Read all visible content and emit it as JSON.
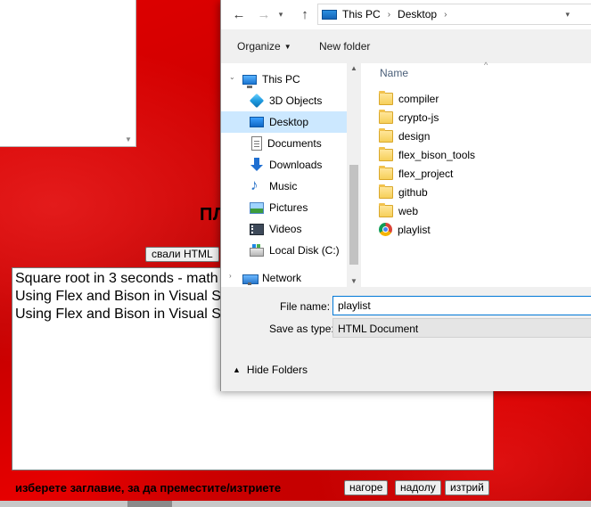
{
  "page": {
    "heading_visible": "ПЛ",
    "download_button_label": "свали HTML",
    "playlist_items": [
      "Square root in 3 seconds - math",
      "Using Flex and Bison in Visual S",
      "Using Flex and Bison in Visual S"
    ],
    "hint_text": "изберете заглавие, за да преместите/изтриете",
    "buttons": {
      "up_label": "нагоре",
      "down_label": "надолу",
      "delete_label": "изтрий"
    }
  },
  "dialog": {
    "nav": {
      "back_icon": "arrow-left-icon",
      "forward_icon": "arrow-right-icon",
      "recent_icon": "chevron-down-icon",
      "up_icon": "arrow-up-icon"
    },
    "breadcrumb": [
      "This PC",
      "Desktop"
    ],
    "toolbar": {
      "organize_label": "Organize",
      "new_folder_label": "New folder"
    },
    "nav_pane": [
      {
        "label": "This PC",
        "icon": "computer-icon"
      },
      {
        "label": "3D Objects",
        "icon": "cube-icon"
      },
      {
        "label": "Desktop",
        "icon": "desktop-icon",
        "selected": true
      },
      {
        "label": "Documents",
        "icon": "document-icon"
      },
      {
        "label": "Downloads",
        "icon": "download-icon"
      },
      {
        "label": "Music",
        "icon": "music-icon"
      },
      {
        "label": "Pictures",
        "icon": "picture-icon"
      },
      {
        "label": "Videos",
        "icon": "video-icon"
      },
      {
        "label": "Local Disk (C:)",
        "icon": "disk-icon"
      },
      {
        "label": "Network",
        "icon": "network-icon"
      }
    ],
    "file_list": {
      "column_name": "Name",
      "items": [
        {
          "name": "compiler",
          "icon": "folder-icon"
        },
        {
          "name": "crypto-js",
          "icon": "folder-icon"
        },
        {
          "name": "design",
          "icon": "folder-icon"
        },
        {
          "name": "flex_bison_tools",
          "icon": "folder-icon"
        },
        {
          "name": "flex_project",
          "icon": "folder-icon"
        },
        {
          "name": "github",
          "icon": "folder-icon"
        },
        {
          "name": "web",
          "icon": "folder-icon"
        },
        {
          "name": "playlist",
          "icon": "chrome-html-icon"
        }
      ]
    },
    "form": {
      "file_name_label": "File name:",
      "file_name_value": "playlist",
      "save_as_type_label": "Save as type:",
      "save_as_type_value": "HTML Document",
      "hide_folders_label": "Hide Folders"
    },
    "colors": {
      "selection": "#cce8ff",
      "focus_border": "#0078d7"
    }
  }
}
